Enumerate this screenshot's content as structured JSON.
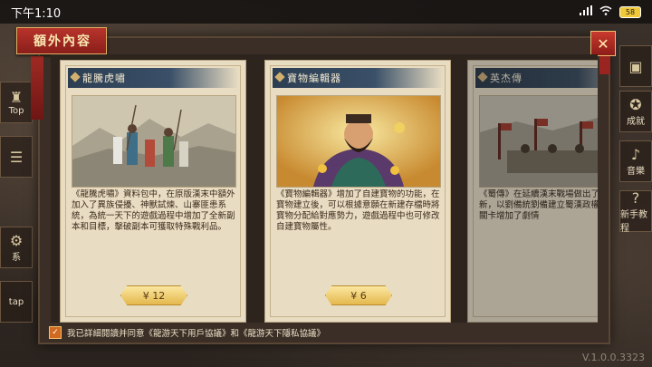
{
  "status_bar": {
    "time": "下午1:10",
    "battery": "58"
  },
  "side_left": {
    "labels": [
      "Top",
      "",
      "系",
      "tap"
    ]
  },
  "side_right": {
    "labels": [
      "",
      "成就",
      "音樂",
      "新手教程"
    ]
  },
  "panel": {
    "title": "額外內容",
    "close_icon": "close-x"
  },
  "cards": [
    {
      "name": "龍騰虎嘯",
      "description": "《龍騰虎嘯》資料包中，在原版漢末中額外加入了異族侵擾、神獸試煉、山寨匪患系統，為統一天下的遊戲過程中增加了全新副本和目標，擊破副本可獲取特殊戰利品。",
      "price": "¥ 12"
    },
    {
      "name": "寶物編輯器",
      "description": "《寶物編輯器》增加了自建寶物的功能，在寶物建立後，可以根據意願在新建存檔時將寶物分配給對應勢力，遊戲過程中也可修改自建寶物屬性。",
      "price": "¥ 6"
    },
    {
      "name": "英杰傳",
      "description": "《蜀傳》在延續漢末戰場做出了一定的創新，以劉備統劉備建立蜀漢政權之路，配合關卡增加了劇情",
      "price": ""
    }
  ],
  "footer": {
    "agreement": "我已詳細閱讀并同意《龍游天下用戶協議》和《龍游天下隱私協議》"
  },
  "version": "V.1.0.0.3323"
}
